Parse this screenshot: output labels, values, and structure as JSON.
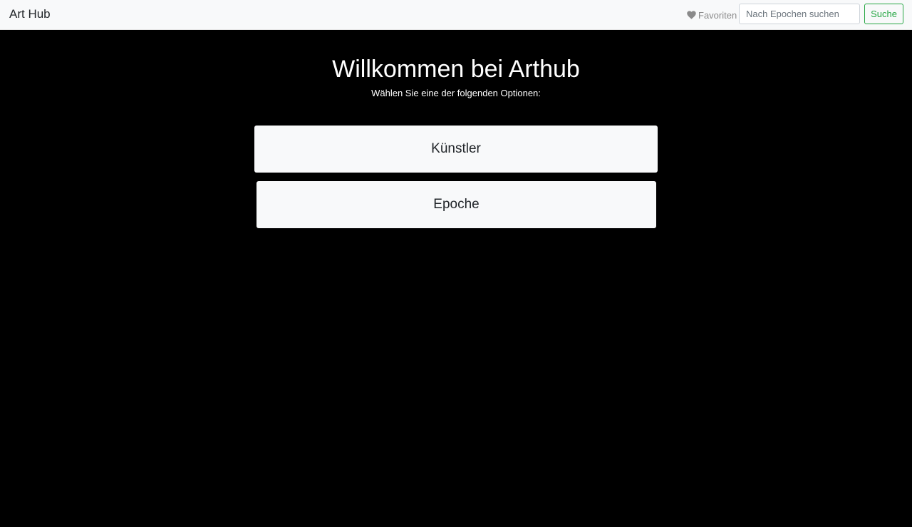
{
  "navbar": {
    "brand": "Art Hub",
    "favorites_label": "Favoriten",
    "favorites_icon": "heart-icon",
    "search": {
      "placeholder": "Nach Epochen suchen",
      "value": "",
      "button_label": "Suche"
    }
  },
  "hero": {
    "title": "Willkommen bei Arthub",
    "subtitle": "Wählen Sie eine der folgenden Optionen:"
  },
  "options": [
    {
      "label": "Künstler"
    },
    {
      "label": "Epoche"
    }
  ],
  "colors": {
    "navbar_bg": "#f8f9fa",
    "page_bg": "#000000",
    "accent_green": "#28a745",
    "muted_text": "#8a8a8a"
  }
}
